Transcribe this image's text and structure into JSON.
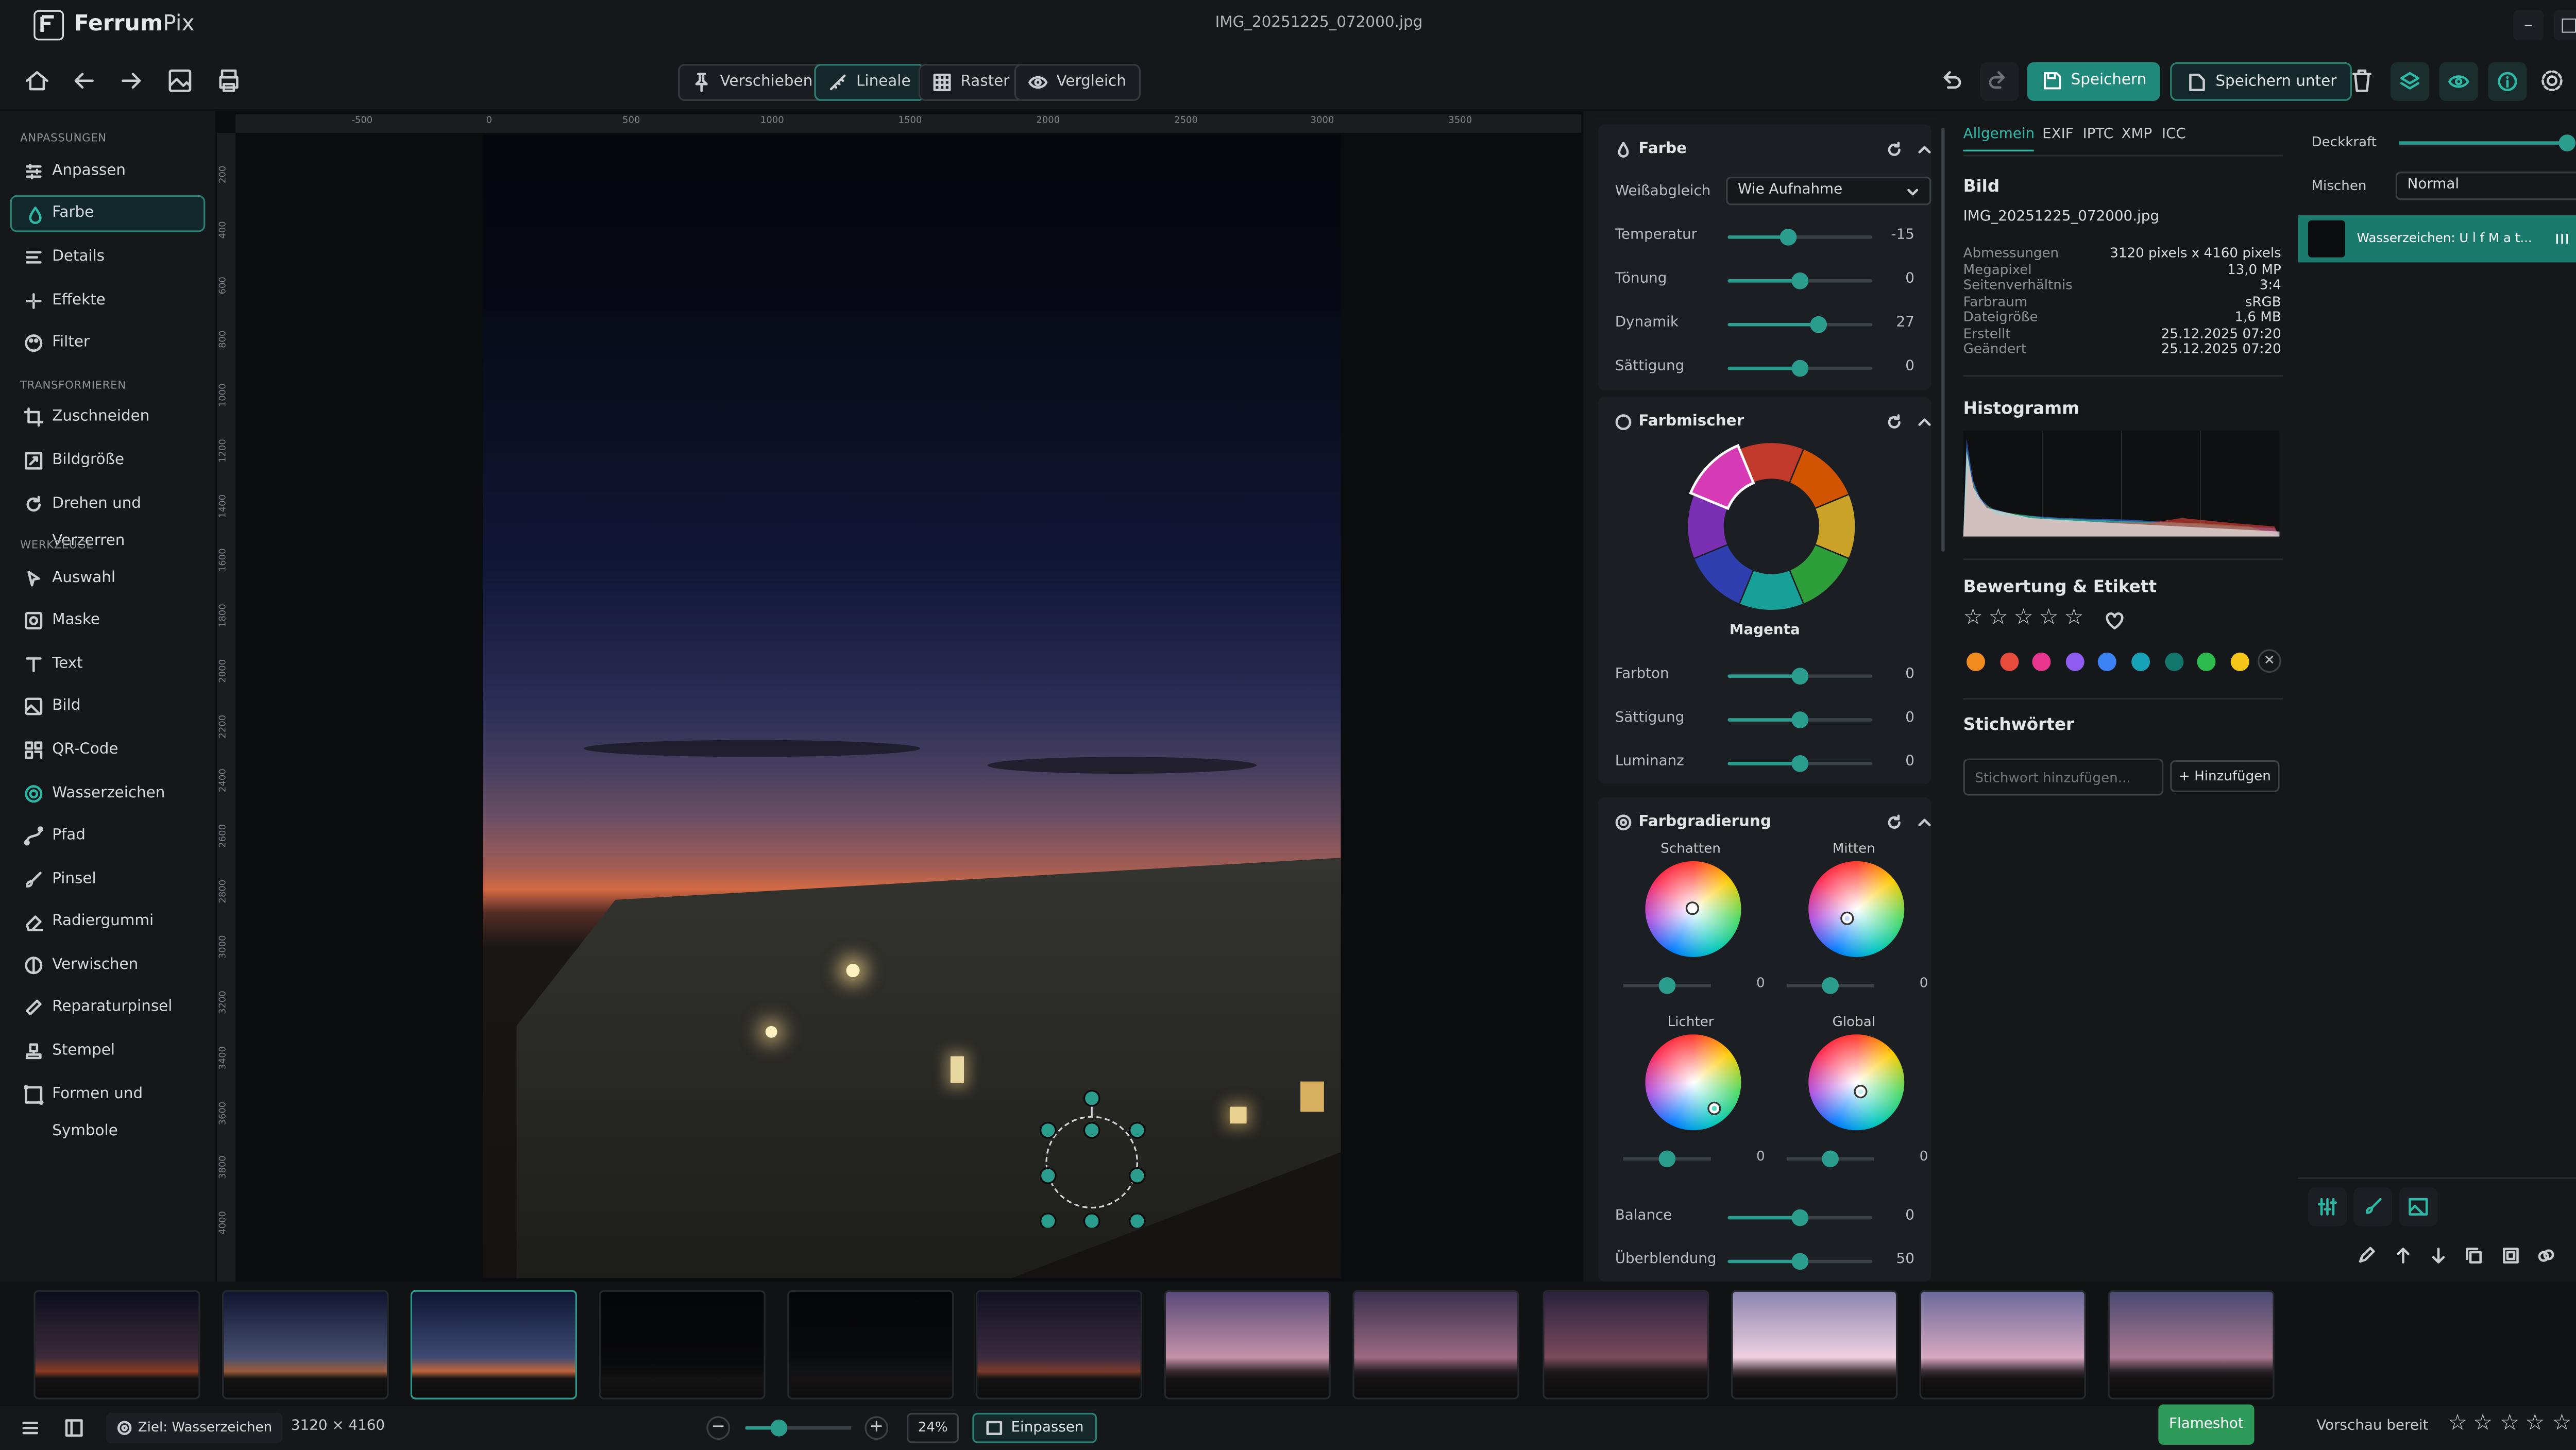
{
  "app": {
    "name_bold": "Ferrum",
    "name_rest": "Pix",
    "file_title": "IMG_20251225_072000.jpg"
  },
  "window": {
    "minimize": "–",
    "maximize": "□",
    "close": "✕"
  },
  "toolbar": {
    "modes": [
      {
        "label": "Verschieben",
        "icon": "pin-icon"
      },
      {
        "label": "Lineale",
        "icon": "ruler-icon",
        "active": true
      },
      {
        "label": "Raster",
        "icon": "grid-icon"
      },
      {
        "label": "Vergleich",
        "icon": "eye-icon"
      }
    ],
    "save": "Speichern",
    "save_as": "Speichern unter",
    "save_color": "#1f8a7b"
  },
  "sidebar": {
    "sections": [
      {
        "title": "ANPASSUNGEN",
        "items": [
          {
            "label": "Anpassen",
            "icon": "sliders-icon"
          },
          {
            "label": "Farbe",
            "icon": "drop-icon",
            "active": true
          },
          {
            "label": "Details",
            "icon": "details-icon"
          },
          {
            "label": "Effekte",
            "icon": "sparkle-icon"
          },
          {
            "label": "Filter",
            "icon": "palette-icon"
          }
        ]
      },
      {
        "title": "TRANSFORMIEREN",
        "items": [
          {
            "label": "Zuschneiden",
            "icon": "crop-icon"
          },
          {
            "label": "Bildgröße",
            "icon": "resize-icon"
          },
          {
            "label": "Drehen und Verzerren",
            "icon": "rotate-icon"
          }
        ]
      },
      {
        "title": "WERKZEUGE",
        "items": [
          {
            "label": "Auswahl",
            "icon": "cursor-icon"
          },
          {
            "label": "Maske",
            "icon": "mask-icon"
          },
          {
            "label": "Text",
            "icon": "text-icon"
          },
          {
            "label": "Bild",
            "icon": "image-icon"
          },
          {
            "label": "QR-Code",
            "icon": "qr-icon"
          },
          {
            "label": "Wasserzeichen",
            "icon": "watermark-icon"
          },
          {
            "label": "Pfad",
            "icon": "path-icon"
          },
          {
            "label": "Pinsel",
            "icon": "brush-icon"
          },
          {
            "label": "Radiergummi",
            "icon": "eraser-icon"
          },
          {
            "label": "Verwischen",
            "icon": "blur-icon"
          },
          {
            "label": "Reparaturpinsel",
            "icon": "bandage-icon"
          },
          {
            "label": "Stempel",
            "icon": "stamp-icon"
          },
          {
            "label": "Formen und Symbole",
            "icon": "shapes-icon"
          }
        ]
      }
    ]
  },
  "rulers": {
    "top": [
      "-500",
      "0",
      "500",
      "1000",
      "1500",
      "2000",
      "2500",
      "3000",
      "3500"
    ],
    "left": [
      "200",
      "400",
      "600",
      "800",
      "1000",
      "1200",
      "1400",
      "1600",
      "1800",
      "2000",
      "2200",
      "2400",
      "2600",
      "2800",
      "3000",
      "3200",
      "3400",
      "3600",
      "3800",
      "4000"
    ]
  },
  "farbe": {
    "title": "Farbe",
    "wb_label": "Weißabgleich",
    "wb_value": "Wie Aufnahme",
    "sliders": [
      {
        "label": "Temperatur",
        "value": "-15",
        "pos": 0.42
      },
      {
        "label": "Tönung",
        "value": "0",
        "pos": 0.5
      },
      {
        "label": "Dynamik",
        "value": "27",
        "pos": 0.63
      },
      {
        "label": "Sättigung",
        "value": "0",
        "pos": 0.5
      }
    ]
  },
  "farbmischer": {
    "title": "Farbmischer",
    "selected": "Magenta",
    "colors": [
      "#c0392b",
      "#d35400",
      "#c9a227",
      "#2e9e3a",
      "#17a097",
      "#2f3fb0",
      "#7b2fb3",
      "#d63ab4"
    ],
    "sliders": [
      {
        "label": "Farbton",
        "value": "0",
        "pos": 0.5
      },
      {
        "label": "Sättigung",
        "value": "0",
        "pos": 0.5
      },
      {
        "label": "Luminanz",
        "value": "0",
        "pos": 0.5
      }
    ]
  },
  "farbgradierung": {
    "title": "Farbgradierung",
    "wheels": [
      {
        "label": "Schatten",
        "value": "0",
        "pos": 0.5
      },
      {
        "label": "Mitten",
        "value": "0",
        "pos": 0.5
      },
      {
        "label": "Lichter",
        "value": "0",
        "pos": 0.5
      },
      {
        "label": "Global",
        "value": "0",
        "pos": 0.5
      }
    ],
    "sliders": [
      {
        "label": "Balance",
        "value": "0",
        "pos": 0.5
      },
      {
        "label": "Überblendung",
        "value": "50",
        "pos": 0.5
      }
    ]
  },
  "info": {
    "tabs": [
      "Allgemein",
      "EXIF",
      "IPTC",
      "XMP",
      "ICC"
    ],
    "bild_title": "Bild",
    "filename": "IMG_20251225_072000.jpg",
    "rows": [
      {
        "label": "Abmessungen",
        "value": "3120 pixels x 4160 pixels"
      },
      {
        "label": "Megapixel",
        "value": "13,0 MP"
      },
      {
        "label": "Seitenverhältnis",
        "value": "3:4"
      },
      {
        "label": "Farbraum",
        "value": "sRGB"
      },
      {
        "label": "Dateigröße",
        "value": "1,6 MB"
      },
      {
        "label": "Erstellt",
        "value": "25.12.2025 07:20"
      },
      {
        "label": "Geändert",
        "value": "25.12.2025 07:20"
      }
    ],
    "histogram_title": "Histogramm",
    "rating_title": "Bewertung & Etikett",
    "rating": 0,
    "label_colors": [
      "#f28c1e",
      "#e74c3c",
      "#e8368f",
      "#8e5cf0",
      "#3b82f6",
      "#17a2b8",
      "#13766d",
      "#2dba4e",
      "#f5c518"
    ],
    "keywords_title": "Stichwörter",
    "keyword_placeholder": "Stichwort hinzufügen...",
    "keyword_add": "+ Hinzufügen"
  },
  "layers": {
    "opacity_label": "Deckkraft",
    "opacity_value": "100",
    "opacity": 1.0,
    "blend_label": "Mischen",
    "blend_value": "Normal",
    "layer_name": "Wasserzeichen: U l f   M a t..."
  },
  "status": {
    "target": "Ziel: Wasserzeichen",
    "size": "3120 × 4160",
    "zoom": "24%",
    "zoom_pos": 0.24,
    "fit": "Einpassen",
    "brand": "Flameshot",
    "preview": "Vorschau bereit"
  },
  "filmstrip": [
    {
      "top": "#0c0e1c",
      "mid": "#3c2b3a",
      "low": "#8a3a22"
    },
    {
      "top": "#101530",
      "mid": "#475070",
      "low": "#9a5a3a"
    },
    {
      "top": "#0d1733",
      "mid": "#3d4a72",
      "low": "#c0643a"
    },
    {
      "top": "#050608",
      "mid": "#08090b",
      "low": "#0c0d0e"
    },
    {
      "top": "#050608",
      "mid": "#0a0b0d",
      "low": "#121314"
    },
    {
      "top": "#121222",
      "mid": "#3a2b40",
      "low": "#7a3a2a"
    },
    {
      "top": "#5a4a7a",
      "mid": "#c492a8",
      "low": "#3a2a30"
    },
    {
      "top": "#3a3050",
      "mid": "#9c6a80",
      "low": "#2a2026"
    },
    {
      "top": "#2a2240",
      "mid": "#7a4a5a",
      "low": "#1e1a1c"
    },
    {
      "top": "#8a86b0",
      "mid": "#f0d0e0",
      "low": "#4a3a40"
    },
    {
      "top": "#6a6a9a",
      "mid": "#d8a8c0",
      "low": "#3a2e36"
    },
    {
      "top": "#4a4a70",
      "mid": "#a87890",
      "low": "#2a2228"
    }
  ]
}
